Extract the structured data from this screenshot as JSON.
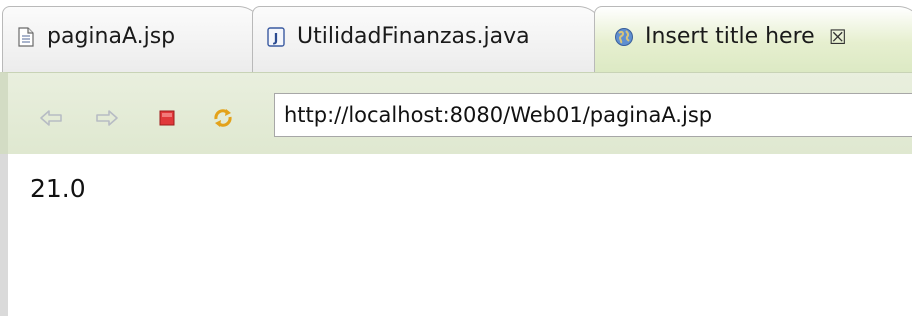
{
  "tabs": [
    {
      "label": "paginaA.jsp",
      "icon": "jsp-file-icon"
    },
    {
      "label": "UtilidadFinanzas.java",
      "icon": "java-file-icon"
    },
    {
      "label": "Insert title here",
      "icon": "globe-icon",
      "close": "☒"
    }
  ],
  "toolbar": {
    "back_icon": "back-arrow-icon",
    "forward_icon": "forward-arrow-icon",
    "stop_icon": "stop-icon",
    "refresh_icon": "refresh-icon",
    "url": "http://localhost:8080/Web01/paginaA.jsp"
  },
  "page": {
    "body_text": "21.0"
  },
  "colors": {
    "active_tab": "#dce9c4",
    "toolbar": "#e3ebd5",
    "stop": "#e0383a"
  }
}
